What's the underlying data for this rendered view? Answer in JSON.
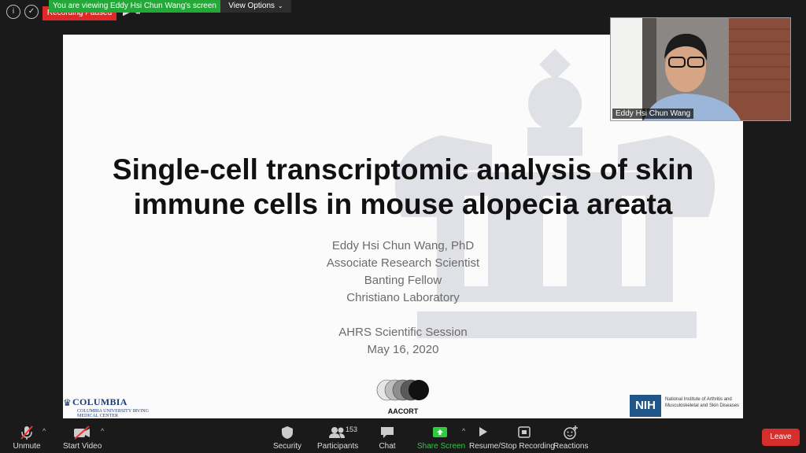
{
  "top_bar": {
    "info_icon": "info-icon",
    "shield_icon": "shield-icon",
    "recording_status": "Recording Paused",
    "viewing_banner": "You are viewing Eddy Hsi Chun Wang's screen",
    "view_options": "View Options"
  },
  "slide": {
    "title_line1": "Single-cell transcriptomic analysis of skin",
    "title_line2": "immune cells in mouse alopecia areata",
    "presenter": "Eddy Hsi Chun Wang, PhD",
    "role": "Associate Research Scientist",
    "fellowship": "Banting Fellow",
    "lab": "Christiano Laboratory",
    "session": "AHRS Scientific Session",
    "date": "May 16, 2020",
    "columbia_name": "COLUMBIA",
    "columbia_sub": "COLUMBIA UNIVERSITY IRVING MEDICAL CENTER",
    "aacort_label": "AACORT",
    "nih_logo": "NIH",
    "nih_text": "National Institute of Arthritis and Musculoskeletal and Skin Diseases"
  },
  "video": {
    "participant_name": "Eddy Hsi Chun Wang"
  },
  "toolbar": {
    "unmute": "Unmute",
    "start_video": "Start Video",
    "security": "Security",
    "participants": "Participants",
    "participants_count": "153",
    "chat": "Chat",
    "share_screen": "Share Screen",
    "recording": "Resume/Stop Recording",
    "reactions": "Reactions",
    "leave": "Leave"
  },
  "colors": {
    "banner_green": "#23a937",
    "share_green": "#2ecc40",
    "leave_red": "#d62d2d",
    "crown_grey": "#dfe1e6"
  }
}
